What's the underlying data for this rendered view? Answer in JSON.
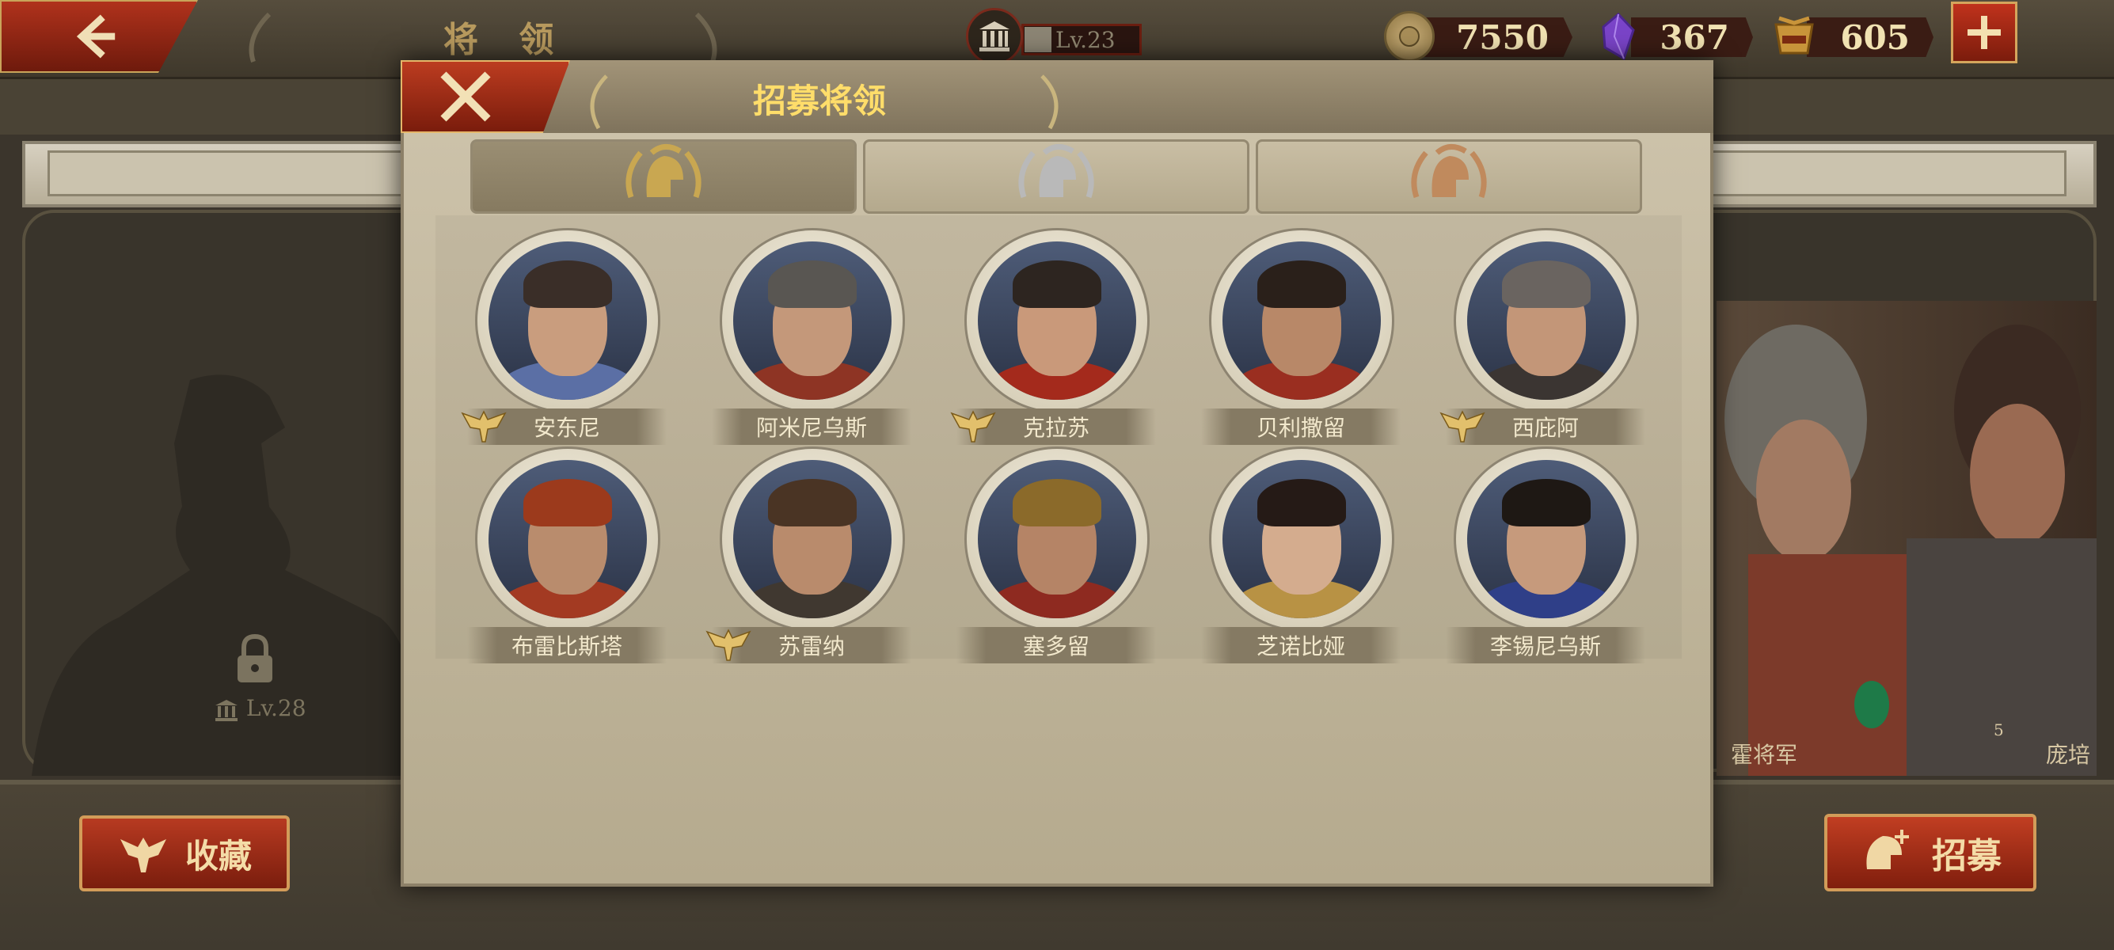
{
  "header": {
    "title": "将 领",
    "level": "Lv.23",
    "resources": [
      {
        "name": "coin-icon",
        "value": "7550",
        "color": "#b79b5a"
      },
      {
        "name": "gem-icon",
        "value": "367",
        "color": "#7a44c8"
      },
      {
        "name": "spqr-icon",
        "value": "605",
        "color": "#c8943a"
      }
    ]
  },
  "background": {
    "locked_level": "Lv.28",
    "favorites_label": "收藏",
    "recruit_label": "招募",
    "general_names": [
      "霍将军",
      "庞培"
    ],
    "badge_number": "5"
  },
  "modal": {
    "title": "招募将领",
    "tabs": [
      {
        "name": "gold",
        "color": "#c9a751"
      },
      {
        "name": "silver",
        "color": "#b9b9b9"
      },
      {
        "name": "bronze",
        "color": "#c08a5d"
      }
    ],
    "generals": [
      {
        "name": "安东尼",
        "eagle": true,
        "skin": "#c99d7e",
        "hair": "#3a2e28",
        "armor": "#5b6fa5"
      },
      {
        "name": "阿米尼乌斯",
        "eagle": false,
        "skin": "#c4987a",
        "hair": "#595652",
        "armor": "#8e3424"
      },
      {
        "name": "克拉苏",
        "eagle": true,
        "skin": "#c9997a",
        "hair": "#2d2520",
        "armor": "#a42a1c"
      },
      {
        "name": "贝利撒留",
        "eagle": false,
        "skin": "#b88868",
        "hair": "#2a201a",
        "armor": "#9a2e20"
      },
      {
        "name": "西庇阿",
        "eagle": true,
        "skin": "#c39678",
        "hair": "#6a6460",
        "armor": "#3b3532"
      },
      {
        "name": "布雷比斯塔",
        "eagle": false,
        "skin": "#b98c6d",
        "hair": "#9c3a1c",
        "armor": "#a33a22"
      },
      {
        "name": "苏雷纳",
        "eagle": true,
        "skin": "#b98b6c",
        "hair": "#4a3424",
        "armor": "#403830"
      },
      {
        "name": "塞多留",
        "eagle": false,
        "skin": "#b58466",
        "hair": "#8b6a2a",
        "armor": "#8e2a20"
      },
      {
        "name": "芝诺比娅",
        "eagle": false,
        "skin": "#d4ac8e",
        "hair": "#251a16",
        "armor": "#b89244"
      },
      {
        "name": "李锡尼乌斯",
        "eagle": false,
        "skin": "#c69a7c",
        "hair": "#1e1814",
        "armor": "#2f3f88"
      }
    ]
  }
}
